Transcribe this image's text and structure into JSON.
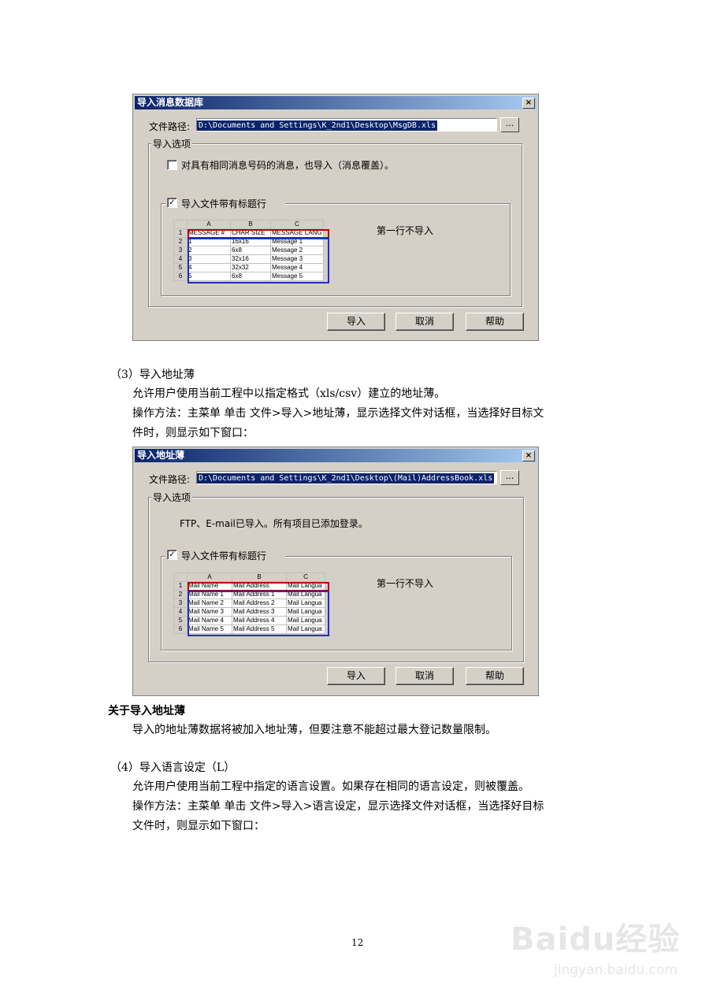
{
  "dialog1": {
    "title": "导入消息数据库",
    "close": "×",
    "path_label": "文件路径:",
    "path_value": "D:\\Documents and Settings\\K_2nd1\\Desktop\\MsgDB.xls",
    "browse": "...",
    "group_label": "导入选项",
    "option_text": "对具有相同消息号码的消息，也导入（消息覆盖）。",
    "option_checked": false,
    "header_row_label": "导入文件带有标题行",
    "header_row_checked": true,
    "note": "第一行不导入",
    "sheet": {
      "cols": [
        "",
        "A",
        "B",
        "C"
      ],
      "rows": [
        [
          "1",
          "MESSAGE #",
          "CHAR SIZE",
          "MESSAGE LANG"
        ],
        [
          "2",
          "1",
          "16x16",
          "Message 1"
        ],
        [
          "3",
          "2",
          "6x8",
          "Message 2"
        ],
        [
          "4",
          "3",
          "32x16",
          "Message 3"
        ],
        [
          "5",
          "4",
          "32x32",
          "Message 4"
        ],
        [
          "6",
          "5",
          "6x8",
          "Message 5"
        ]
      ]
    },
    "buttons": {
      "import": "导入",
      "cancel": "取消",
      "help": "帮助"
    }
  },
  "section3": {
    "heading": "（3）导入地址薄",
    "line1": "允许用户使用当前工程中以指定格式（xls/csv）建立的地址薄。",
    "line2": "操作方法：主菜单 单击 文件>导入>地址薄，显示选择文件对话框，当选择好目标文",
    "line3": "件时，则显示如下窗口："
  },
  "dialog2": {
    "title": "导入地址薄",
    "close": "×",
    "path_label": "文件路径:",
    "path_value": "D:\\Documents and Settings\\K_2nd1\\Desktop\\(Mail)AddressBook.xls",
    "browse": "...",
    "group_label": "导入选项",
    "info_text": "FTP、E-mail已导入。所有项目已添加登录。",
    "header_row_label": "导入文件带有标题行",
    "header_row_checked": true,
    "note": "第一行不导入",
    "sheet": {
      "cols": [
        "",
        "A",
        "B",
        "C"
      ],
      "rows": [
        [
          "1",
          "Mail Name",
          "Mail Address",
          "Mail Langua"
        ],
        [
          "2",
          "Mail Name 1",
          "Mail Address 1",
          "Mail Langua"
        ],
        [
          "3",
          "Mail Name 2",
          "Mail Address 2",
          "Mail Langua"
        ],
        [
          "4",
          "Mail Name 3",
          "Mail Address 3",
          "Mail Langua"
        ],
        [
          "5",
          "Mail Name 4",
          "Mail Address 4",
          "Mail Langua"
        ],
        [
          "6",
          "Mail Name 5",
          "Mail Address 5",
          "Mail Langua"
        ]
      ]
    },
    "buttons": {
      "import": "导入",
      "cancel": "取消",
      "help": "帮助"
    }
  },
  "about": {
    "heading": "关于导入地址薄",
    "line1": "导入的地址薄数据将被加入地址薄，但要注意不能超过最大登记数量限制。"
  },
  "section4": {
    "heading": "（4）导入语言设定（L）",
    "line1": "允许用户使用当前工程中指定的语言设置。如果存在相同的语言设定，则被覆盖。",
    "line2": "操作方法：主菜单 单击 文件>导入>语言设定，显示选择文件对话框，当选择好目标",
    "line3": "文件时，则显示如下窗口："
  },
  "page_number": "12",
  "watermark": {
    "logo": "Baidu经验",
    "url": "jingyan.baidu.com"
  }
}
